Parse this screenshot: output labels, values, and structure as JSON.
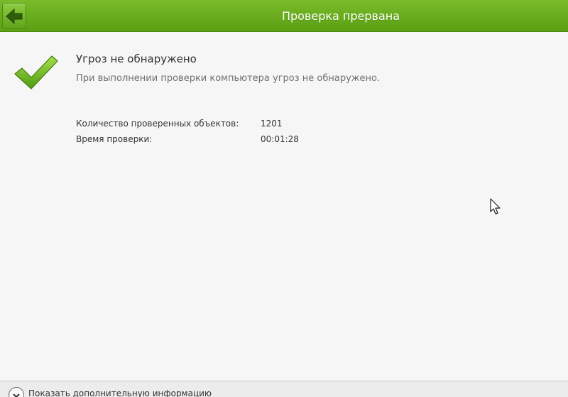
{
  "header": {
    "title": "Проверка прервана",
    "back_icon": "arrow-left-icon",
    "accent_color": "#5fa51c"
  },
  "result": {
    "icon": "checkmark-icon",
    "title": "Угроз не обнаружено",
    "description": "При выполнении проверки компьютера угроз не обнаружено."
  },
  "stats": [
    {
      "label": "Количество проверенных объектов:",
      "value": "1201"
    },
    {
      "label": "Время проверки:",
      "value": "00:01:28"
    }
  ],
  "footer": {
    "toggle_icon": "chevron-down-icon",
    "expand_label": "Показать дополнительную информацию"
  }
}
